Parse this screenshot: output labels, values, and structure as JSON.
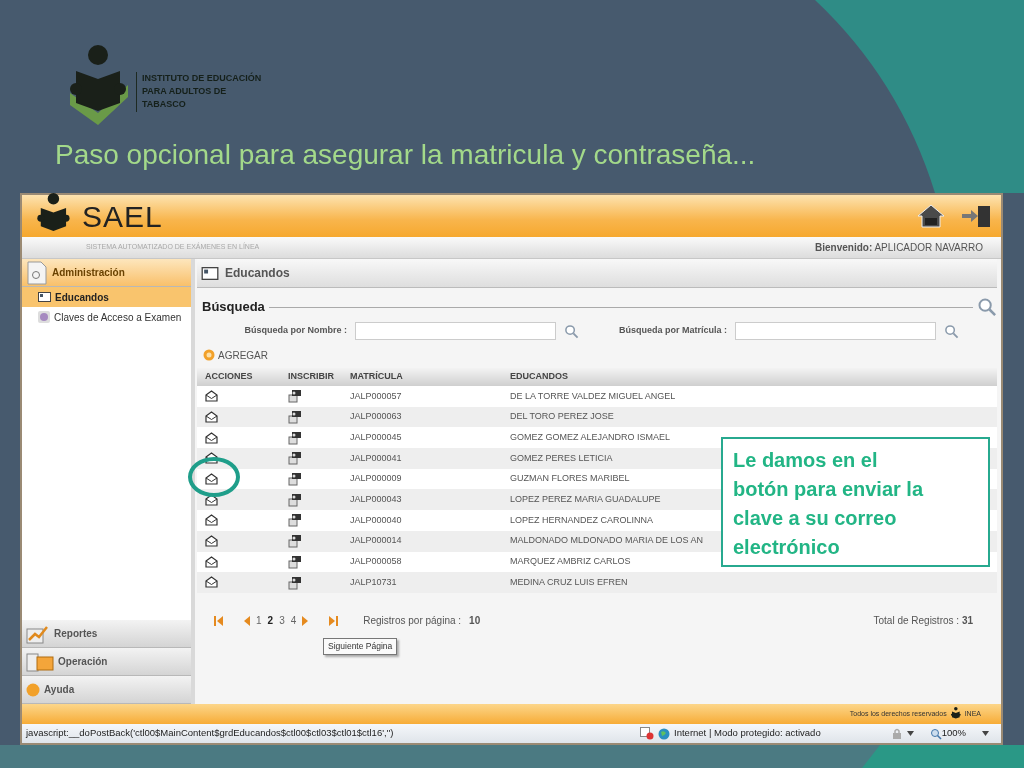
{
  "org": {
    "lines": [
      "INSTITUTO DE EDUCACIÓN",
      "PARA ADULTOS DE",
      "TABASCO"
    ]
  },
  "slide_title": "Paso opcional para asegurar la matricula y contraseña...",
  "app": {
    "logo": "SAEL",
    "subtitle": "SISTEMA AUTOMATIZADO DE EXÁMENES EN LÍNEA",
    "welcome_label": "Bienvenido:",
    "welcome_user": "APLICADOR NAVARRO"
  },
  "sidebar": {
    "sections": [
      {
        "label": "Administración",
        "kind": "admin",
        "expanded": true,
        "items": [
          {
            "label": "Educandos",
            "kind": "card",
            "selected": true
          },
          {
            "label": "Claves de Acceso a Examen",
            "kind": "disc",
            "selected": false
          }
        ]
      },
      {
        "label": "Reportes",
        "kind": "chart",
        "expanded": false
      },
      {
        "label": "Operación",
        "kind": "folder",
        "expanded": false
      },
      {
        "label": "Ayuda",
        "kind": "help",
        "expanded": false
      }
    ]
  },
  "panel": {
    "title": "Educandos",
    "search_legend": "Búsqueda",
    "fields": [
      {
        "label": "Búsqueda por Nombre :"
      },
      {
        "label": "Búsqueda por Matrícula :"
      }
    ],
    "add_button": "AGREGAR"
  },
  "table": {
    "columns": [
      "ACCIONES",
      "INSCRIBIR",
      "MATRÍCULA",
      "EDUCANDOS"
    ],
    "rows": [
      {
        "matricula": "JALP000057",
        "name": "DE LA TORRE VALDEZ MIGUEL ANGEL"
      },
      {
        "matricula": "JALP000063",
        "name": "DEL TORO PEREZ JOSE"
      },
      {
        "matricula": "JALP000045",
        "name": "GOMEZ GOMEZ ALEJANDRO ISMAEL"
      },
      {
        "matricula": "JALP000041",
        "name": "GOMEZ PERES LETICIA"
      },
      {
        "matricula": "JALP000009",
        "name": "GUZMAN FLORES MARIBEL"
      },
      {
        "matricula": "JALP000043",
        "name": "LOPEZ PEREZ MARIA GUADALUPE"
      },
      {
        "matricula": "JALP000040",
        "name": "LOPEZ HERNANDEZ CAROLINNA"
      },
      {
        "matricula": "JALP000014",
        "name": "MALDONADO MLDONADO MARIA DE LOS AN"
      },
      {
        "matricula": "JALP000058",
        "name": "MARQUEZ AMBRIZ CARLOS"
      },
      {
        "matricula": "JALP10731",
        "name": "MEDINA CRUZ LUIS EFREN"
      }
    ]
  },
  "pager": {
    "pages": [
      {
        "label": "1",
        "selected": false
      },
      {
        "label": "2",
        "selected": true
      },
      {
        "label": "3",
        "selected": false
      },
      {
        "label": "4",
        "selected": false
      }
    ],
    "per_page_label": "Registros por página :",
    "per_page": "10",
    "total_label": "Total de Registros :",
    "total": "31",
    "tooltip": "Siguiente Página"
  },
  "footer": {
    "rights": "Todos los derechos reservados",
    "brand": "INEA"
  },
  "status_bar": {
    "url": "javascript:__doPostBack('ctl00$MainContent$grdEducandos$ctl00$ctl03$ctl01$ctl16','')",
    "zone": "Internet | Modo protegido: activado",
    "zoom": "100%"
  },
  "callout": {
    "lines": [
      "Le damos en el",
      "botón para enviar la",
      "clave a su correo",
      "electrónico"
    ]
  }
}
